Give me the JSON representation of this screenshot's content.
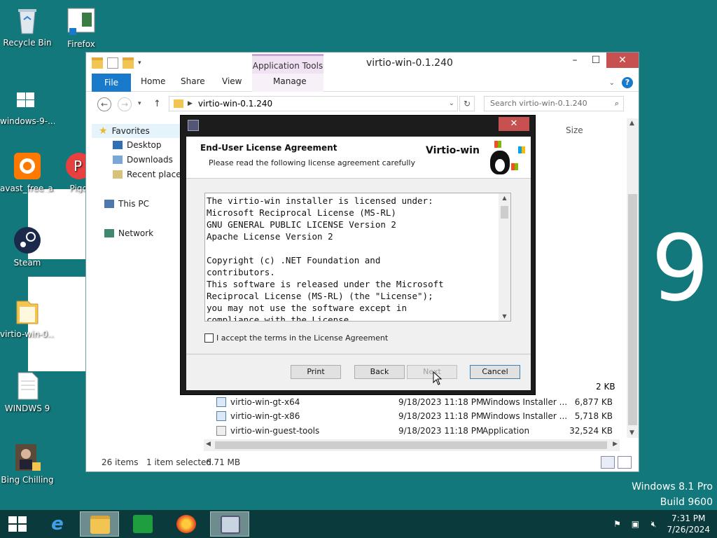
{
  "desktop": {
    "icons": [
      {
        "label": "Recycle Bin",
        "icon": "recycle-bin-icon"
      },
      {
        "label": "Firefox",
        "icon": "shortcut-icon"
      },
      {
        "label": "windows-9-...",
        "icon": "windows-logo-icon"
      },
      {
        "label": "avast_free_a...",
        "icon": "avast-icon"
      },
      {
        "label": "Pigc",
        "icon": "app-icon"
      },
      {
        "label": "Steam",
        "icon": "steam-icon"
      },
      {
        "label": "virtio-win-0....",
        "icon": "folder-icon"
      },
      {
        "label": "WINDWS 9",
        "icon": "document-icon"
      },
      {
        "label": "Bing Chilling",
        "icon": "video-icon"
      }
    ],
    "big_number": "9",
    "watermark_line1": "Windows 8.1 Pro",
    "watermark_line2": "Build 9600"
  },
  "explorer": {
    "title": "virtio-win-0.1.240",
    "contextual_tab_group": "Application Tools",
    "ribbon_tabs": {
      "file": "File",
      "home": "Home",
      "share": "Share",
      "view": "View",
      "manage": "Manage"
    },
    "address_path": "virtio-win-0.1.240",
    "search_placeholder": "Search virtio-win-0.1.240",
    "nav": {
      "favorites": "Favorites",
      "desktop": "Desktop",
      "downloads": "Downloads",
      "recent": "Recent places",
      "this_pc": "This PC",
      "network": "Network"
    },
    "column_size": "Size",
    "partial_size": "2 KB",
    "files": [
      {
        "name": "virtio-win-gt-x64",
        "date": "9/18/2023 11:18 PM",
        "type": "Windows Installer ...",
        "size": "6,877 KB"
      },
      {
        "name": "virtio-win-gt-x86",
        "date": "9/18/2023 11:18 PM",
        "type": "Windows Installer ...",
        "size": "5,718 KB"
      },
      {
        "name": "virtio-win-guest-tools",
        "date": "9/18/2023 11:18 PM",
        "type": "Application",
        "size": "32,524 KB"
      }
    ],
    "status": {
      "items": "26 items",
      "selected": "1 item selected",
      "selected_size": "6.71 MB"
    }
  },
  "dialog": {
    "close_label": "✕",
    "header_title": "End-User License Agreement",
    "header_subtitle": "Please read the following license agreement carefully",
    "brand": "Virtio-win",
    "license_text": "The virtio-win installer is licensed under:\nMicrosoft Reciprocal License (MS-RL)\nGNU GENERAL PUBLIC LICENSE Version 2\nApache License Version 2\n\nCopyright (c) .NET Foundation and\ncontributors.\nThis software is released under the Microsoft\nReciprocal License (MS-RL) (the \"License\");\nyou may not use the software except in\ncompliance with the License.",
    "accept_label": "I accept the terms in the License Agreement",
    "buttons": {
      "print": "Print",
      "back": "Back",
      "next": "Next",
      "cancel": "Cancel"
    }
  },
  "taskbar": {
    "time": "7:31 PM",
    "date": "7/26/2024"
  },
  "colors": {
    "desktop_bg": "#13787b",
    "taskbar_bg": "#0b3a3c",
    "accent_blue": "#1979ca",
    "close_red": "#c75050"
  }
}
